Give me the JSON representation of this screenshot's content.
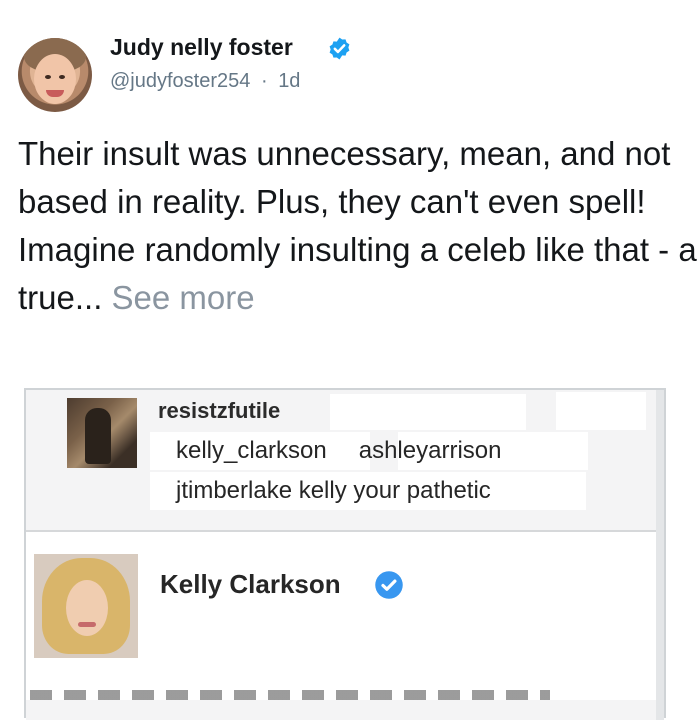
{
  "tweet": {
    "author_name": "Judy nelly foster",
    "handle": "@judyfoster254",
    "separator": "·",
    "time": "1d",
    "text": "Their insult was unnecessary, mean, and not based in reality. Plus, they can't even spell! Imagine randomly insulting a celeb like that - a true...",
    "see_more": "See more",
    "verified_color": "#1da1f2"
  },
  "embedded_screenshot": {
    "comment": {
      "username": "resistzfutile",
      "mention_1": "kelly_clarkson",
      "mention_2": "ashleyarrison",
      "line_2": "jtimberlake kelly your pathetic"
    },
    "reply": {
      "name": "Kelly Clarkson",
      "verified_color": "#3897f0"
    }
  },
  "icons": {
    "verified_1": "verified-badge-icon",
    "verified_2": "verified-badge-icon"
  }
}
